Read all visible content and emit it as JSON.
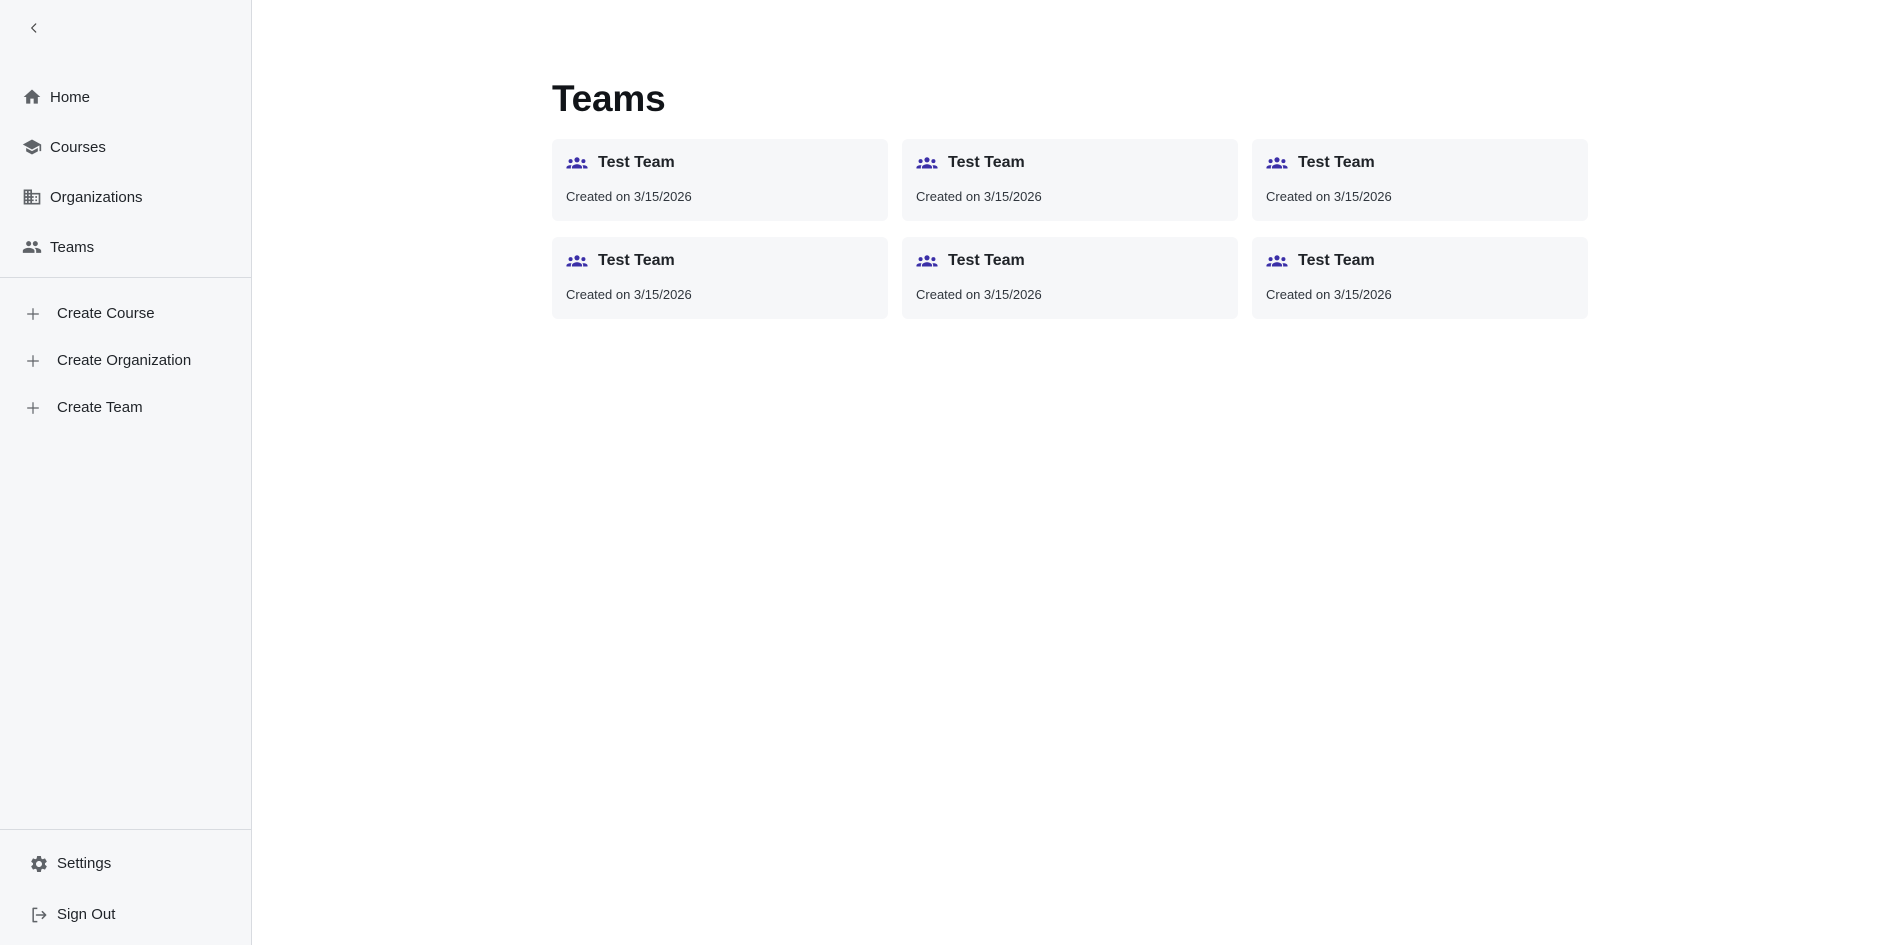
{
  "sidebar": {
    "nav": [
      {
        "label": "Home",
        "icon": "home-icon"
      },
      {
        "label": "Courses",
        "icon": "graduation-cap-icon"
      },
      {
        "label": "Organizations",
        "icon": "building-icon"
      },
      {
        "label": "Teams",
        "icon": "people-icon"
      }
    ],
    "actions": [
      {
        "label": "Create Course",
        "icon": "plus-icon"
      },
      {
        "label": "Create Organization",
        "icon": "plus-icon"
      },
      {
        "label": "Create Team",
        "icon": "plus-icon"
      }
    ],
    "bottom": [
      {
        "label": "Settings",
        "icon": "gear-icon"
      },
      {
        "label": "Sign Out",
        "icon": "sign-out-icon"
      }
    ]
  },
  "main": {
    "title": "Teams",
    "teams": [
      {
        "name": "Test Team",
        "created": "Created on 3/15/2026"
      },
      {
        "name": "Test Team",
        "created": "Created on 3/15/2026"
      },
      {
        "name": "Test Team",
        "created": "Created on 3/15/2026"
      },
      {
        "name": "Test Team",
        "created": "Created on 3/15/2026"
      },
      {
        "name": "Test Team",
        "created": "Created on 3/15/2026"
      },
      {
        "name": "Test Team",
        "created": "Created on 3/15/2026"
      }
    ]
  },
  "colors": {
    "accent": "#3b2fa8",
    "sidebar_bg": "#f6f7f9",
    "card_bg": "#f6f7f9",
    "icon_gray": "#5f6368"
  }
}
